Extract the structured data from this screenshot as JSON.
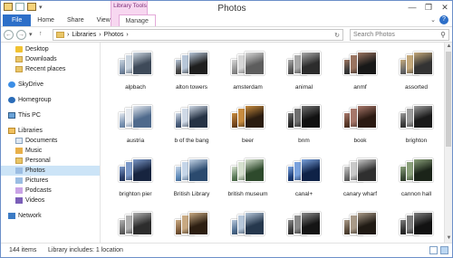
{
  "window": {
    "title": "Photos",
    "context_tab_group": "Library Tools",
    "controls": [
      "—",
      "❐",
      "✕"
    ]
  },
  "ribbon": {
    "tabs": [
      {
        "label": "File"
      },
      {
        "label": "Home"
      },
      {
        "label": "Share"
      },
      {
        "label": "View"
      },
      {
        "label": "Manage"
      }
    ],
    "expand_icon": "chevron-down-icon",
    "help": "?"
  },
  "navigation": {
    "back": "←",
    "forward": "→",
    "recent": "▾",
    "up": "↑",
    "address": {
      "root": "Libraries",
      "sep1": "›",
      "current": "Photos",
      "sep2": "›",
      "refresh": "↻"
    },
    "search_placeholder": "Search Photos"
  },
  "sidebar": {
    "items": [
      {
        "label": "Desktop",
        "icon": "star-icon",
        "indent": 1
      },
      {
        "label": "Downloads",
        "icon": "folder-icon",
        "indent": 1
      },
      {
        "label": "Recent places",
        "icon": "folder-icon",
        "indent": 1
      },
      {
        "label": "SkyDrive",
        "icon": "skydrive-icon",
        "indent": 0,
        "group": true
      },
      {
        "label": "Homegroup",
        "icon": "homegroup-icon",
        "indent": 0,
        "group": true
      },
      {
        "label": "This PC",
        "icon": "computer-icon",
        "indent": 0,
        "group": true
      },
      {
        "label": "Libraries",
        "icon": "library-icon",
        "indent": 0,
        "group": true
      },
      {
        "label": "Documents",
        "icon": "document-icon",
        "indent": 1
      },
      {
        "label": "Music",
        "icon": "music-icon",
        "indent": 1
      },
      {
        "label": "Personal",
        "icon": "folder-icon",
        "indent": 1
      },
      {
        "label": "Photos",
        "icon": "photo-icon",
        "indent": 1,
        "selected": true
      },
      {
        "label": "Pictures",
        "icon": "photo-icon",
        "indent": 1
      },
      {
        "label": "Podcasts",
        "icon": "podcast-icon",
        "indent": 1
      },
      {
        "label": "Videos",
        "icon": "video-icon",
        "indent": 1
      },
      {
        "label": "Network",
        "icon": "network-icon",
        "indent": 0,
        "group": true
      }
    ]
  },
  "folders": [
    {
      "label": "alpbach",
      "colors": [
        "#7b8fa8",
        "#c9d4df",
        "#3e4a59"
      ]
    },
    {
      "label": "alton towers",
      "colors": [
        "#4a4a4a",
        "#b7c6d8",
        "#1f1f1f"
      ]
    },
    {
      "label": "amsterdam",
      "colors": [
        "#8e8e8e",
        "#d6d6d6",
        "#5d5d5d"
      ]
    },
    {
      "label": "animal",
      "colors": [
        "#5a5a5a",
        "#a9a9a9",
        "#2c2c2c"
      ]
    },
    {
      "label": "anmf",
      "colors": [
        "#3b3b3b",
        "#9a7460",
        "#181818"
      ]
    },
    {
      "label": "assorted",
      "colors": [
        "#6b6b6b",
        "#c4a87a",
        "#333333"
      ]
    },
    {
      "label": "austria",
      "colors": [
        "#7993b3",
        "#e5e9ef",
        "#4f6a8c"
      ]
    },
    {
      "label": "b of the bang",
      "colors": [
        "#4a5f7d",
        "#cfd9e6",
        "#263345"
      ]
    },
    {
      "label": "beer",
      "colors": [
        "#7a4a1f",
        "#c78b3e",
        "#2a1c10"
      ]
    },
    {
      "label": "bnm",
      "colors": [
        "#2a2a2a",
        "#6f6f6f",
        "#111111"
      ]
    },
    {
      "label": "book",
      "colors": [
        "#5b3a2a",
        "#a7776a",
        "#2b1a12"
      ]
    },
    {
      "label": "brighton",
      "colors": [
        "#3f3f3f",
        "#9c9c9c",
        "#1a1a1a"
      ]
    },
    {
      "label": "brighton pier",
      "colors": [
        "#2b3f6b",
        "#7b98c8",
        "#17243f"
      ]
    },
    {
      "label": "British Library",
      "colors": [
        "#5c88b7",
        "#c5d5e8",
        "#2b4a6e"
      ]
    },
    {
      "label": "british museum",
      "colors": [
        "#5a7a58",
        "#d5e0ce",
        "#2e4a2c"
      ]
    },
    {
      "label": "canal+",
      "colors": [
        "#1e3f7a",
        "#7aa2dd",
        "#0f2247"
      ]
    },
    {
      "label": "canary wharf",
      "colors": [
        "#6f6f6f",
        "#c9c9c9",
        "#2f2f2f"
      ]
    },
    {
      "label": "cannon hall",
      "colors": [
        "#3e4e38",
        "#8aa07a",
        "#1b2419"
      ]
    },
    {
      "label": "",
      "colors": [
        "#6a6a6a",
        "#b0b0b0",
        "#2d2d2d"
      ]
    },
    {
      "label": "",
      "colors": [
        "#7e5b3a",
        "#c8a982",
        "#2d1f12"
      ]
    },
    {
      "label": "",
      "colors": [
        "#4d6c8f",
        "#b6c7da",
        "#26384d"
      ]
    },
    {
      "label": "",
      "colors": [
        "#3a3a3a",
        "#8a8a8a",
        "#151515"
      ]
    },
    {
      "label": "",
      "colors": [
        "#594a3a",
        "#a99a88",
        "#201a14"
      ]
    },
    {
      "label": "",
      "colors": [
        "#2e2e2e",
        "#7d7d7d",
        "#121212"
      ]
    }
  ],
  "status": {
    "item_count": "144 items",
    "library_info": "Library includes: 1 location"
  }
}
